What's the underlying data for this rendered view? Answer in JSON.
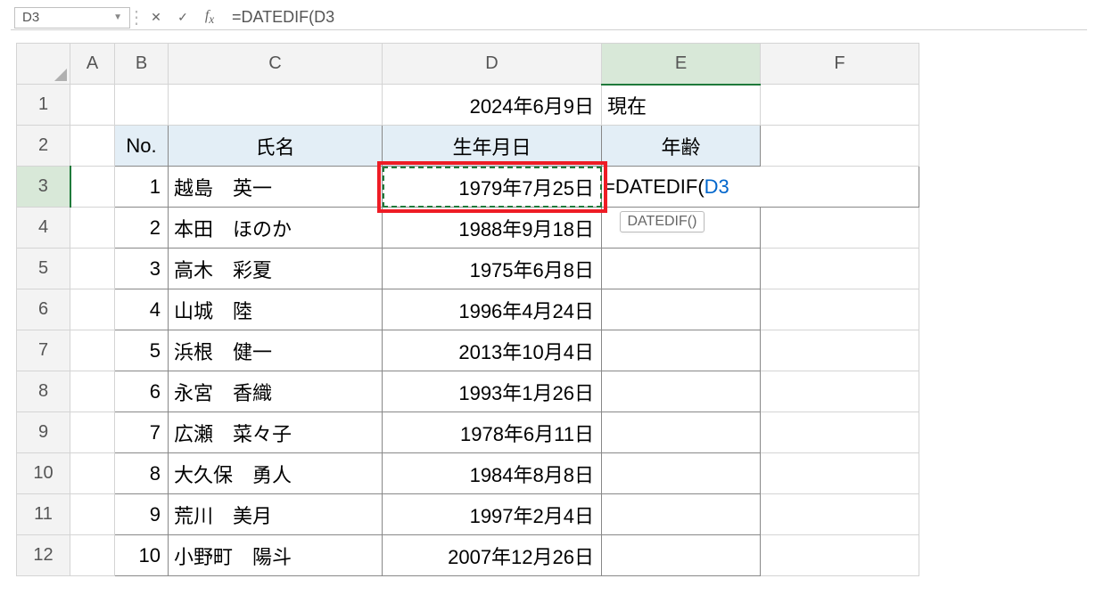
{
  "namebox": "D3",
  "formula_bar": "=DATEDIF(D3",
  "tooltip": "DATEDIF()",
  "columns": [
    "A",
    "B",
    "C",
    "D",
    "E",
    "F"
  ],
  "rows": [
    "1",
    "2",
    "3",
    "4",
    "5",
    "6",
    "7",
    "8",
    "9",
    "10",
    "11",
    "12"
  ],
  "row1": {
    "D": "2024年6月9日",
    "E": "現在"
  },
  "headers": {
    "B": "No.",
    "C": "氏名",
    "D": "生年月日",
    "E": "年齢"
  },
  "people": [
    {
      "no": "1",
      "name": "越島　英一",
      "dob": "1979年7月25日"
    },
    {
      "no": "2",
      "name": "本田　ほのか",
      "dob": "1988年9月18日"
    },
    {
      "no": "3",
      "name": "高木　彩夏",
      "dob": "1975年6月8日"
    },
    {
      "no": "4",
      "name": "山城　陸",
      "dob": "1996年4月24日"
    },
    {
      "no": "5",
      "name": "浜根　健一",
      "dob": "2013年10月4日"
    },
    {
      "no": "6",
      "name": "永宮　香織",
      "dob": "1993年1月26日"
    },
    {
      "no": "7",
      "name": "広瀬　菜々子",
      "dob": "1978年6月11日"
    },
    {
      "no": "8",
      "name": "大久保　勇人",
      "dob": "1984年8月8日"
    },
    {
      "no": "9",
      "name": "荒川　美月",
      "dob": "1997年2月4日"
    },
    {
      "no": "10",
      "name": "小野町　陽斗",
      "dob": "2007年12月26日"
    }
  ],
  "e3_formula": {
    "prefix": "=DATEDIF(",
    "ref": "D3"
  }
}
